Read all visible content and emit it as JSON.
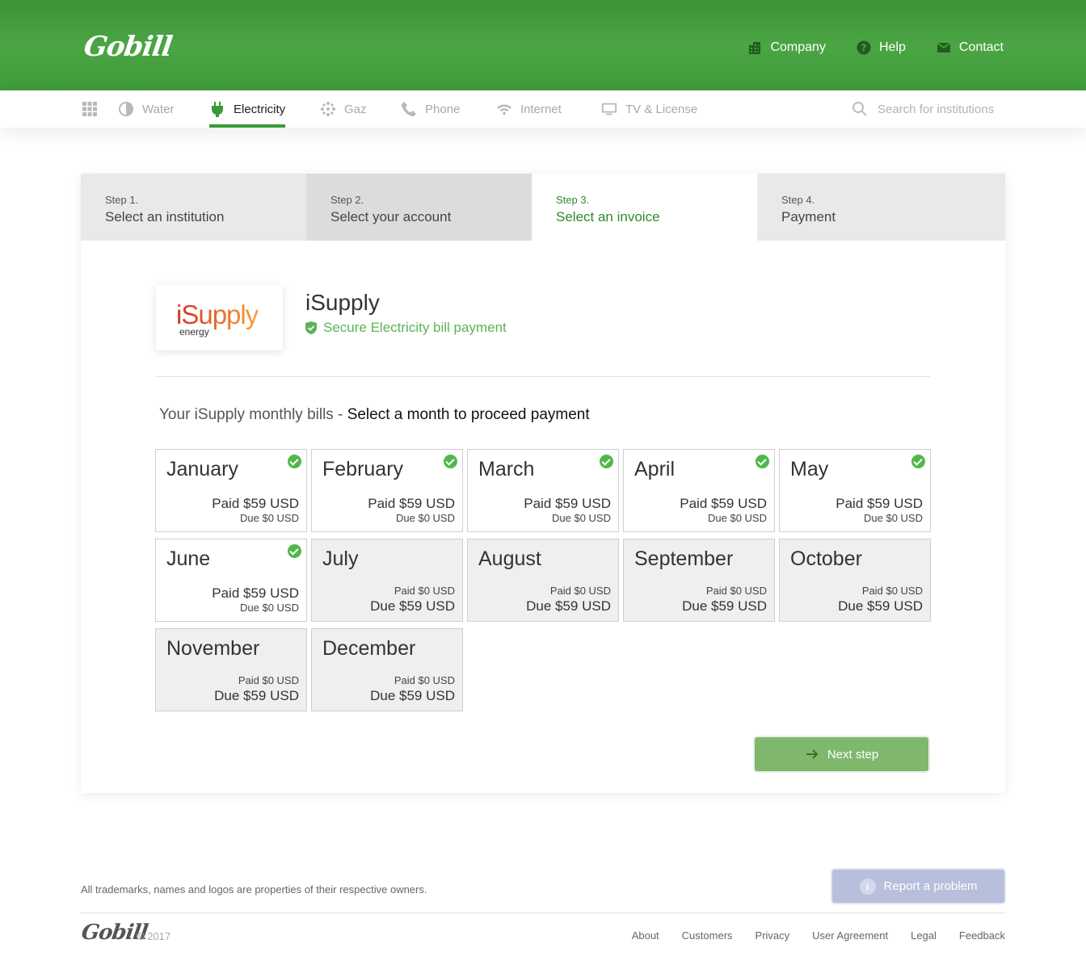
{
  "header": {
    "logo": "Gobill",
    "nav": [
      {
        "label": "Company",
        "icon": "building-icon"
      },
      {
        "label": "Help",
        "icon": "help-icon"
      },
      {
        "label": "Contact",
        "icon": "mail-icon"
      }
    ]
  },
  "categories": [
    {
      "label": "Water",
      "icon": "water-drop-icon"
    },
    {
      "label": "Electricity",
      "icon": "plug-icon",
      "active": true
    },
    {
      "label": "Gaz",
      "icon": "gas-icon"
    },
    {
      "label": "Phone",
      "icon": "phone-icon"
    },
    {
      "label": "Internet",
      "icon": "wifi-icon"
    },
    {
      "label": "TV & License",
      "icon": "tv-icon"
    }
  ],
  "search": {
    "placeholder": "Search for institutions"
  },
  "steps": [
    {
      "num": "Step 1.",
      "title": "Select an institution"
    },
    {
      "num": "Step 2.",
      "title": "Select your account"
    },
    {
      "num": "Step 3.",
      "title": "Select an invoice",
      "active": true
    },
    {
      "num": "Step 4.",
      "title": "Payment"
    }
  ],
  "institution": {
    "logo_text": "iSupply",
    "logo_sub": "energy",
    "name": "iSupply",
    "secure_text": "Secure Electricity bill  payment"
  },
  "bills": {
    "heading_prefix": "Your iSupply monthly bills - ",
    "heading_emphasis": "Select a month to proceed payment",
    "months": [
      {
        "name": "January",
        "status": "paid",
        "paid": "Paid $59 USD",
        "due": "Due $0 USD"
      },
      {
        "name": "February",
        "status": "paid",
        "paid": "Paid $59 USD",
        "due": "Due $0 USD"
      },
      {
        "name": "March",
        "status": "paid",
        "paid": "Paid $59 USD",
        "due": "Due $0 USD"
      },
      {
        "name": "April",
        "status": "paid",
        "paid": "Paid $59 USD",
        "due": "Due $0 USD"
      },
      {
        "name": "May",
        "status": "paid",
        "paid": "Paid $59 USD",
        "due": "Due $0 USD"
      },
      {
        "name": "June",
        "status": "paid",
        "paid": "Paid $59 USD",
        "due": "Due $0 USD"
      },
      {
        "name": "July",
        "status": "due",
        "paid": "Paid $0 USD",
        "due": "Due $59 USD"
      },
      {
        "name": "August",
        "status": "due",
        "paid": "Paid $0 USD",
        "due": "Due $59 USD"
      },
      {
        "name": "September",
        "status": "due",
        "paid": "Paid $0 USD",
        "due": "Due $59 USD"
      },
      {
        "name": "October",
        "status": "due",
        "paid": "Paid $0 USD",
        "due": "Due $59 USD"
      },
      {
        "name": "November",
        "status": "due",
        "paid": "Paid $0 USD",
        "due": "Due $59 USD"
      },
      {
        "name": "December",
        "status": "due",
        "paid": "Paid $0 USD",
        "due": "Due $59 USD"
      }
    ]
  },
  "next_button": "Next step",
  "footer": {
    "trademark": "All trademarks, names and logos are properties of their respective owners.",
    "report_button": "Report a problem",
    "logo": "Gobill",
    "year": "© 2017",
    "links": [
      "About",
      "Customers",
      "Privacy",
      "User Agreement",
      "Legal",
      "Feedback"
    ]
  },
  "colors": {
    "brand_green": "#4ba544",
    "paid_check": "#50b84a",
    "next_button": "#7fb86d",
    "report_button": "#b7bfdc"
  }
}
